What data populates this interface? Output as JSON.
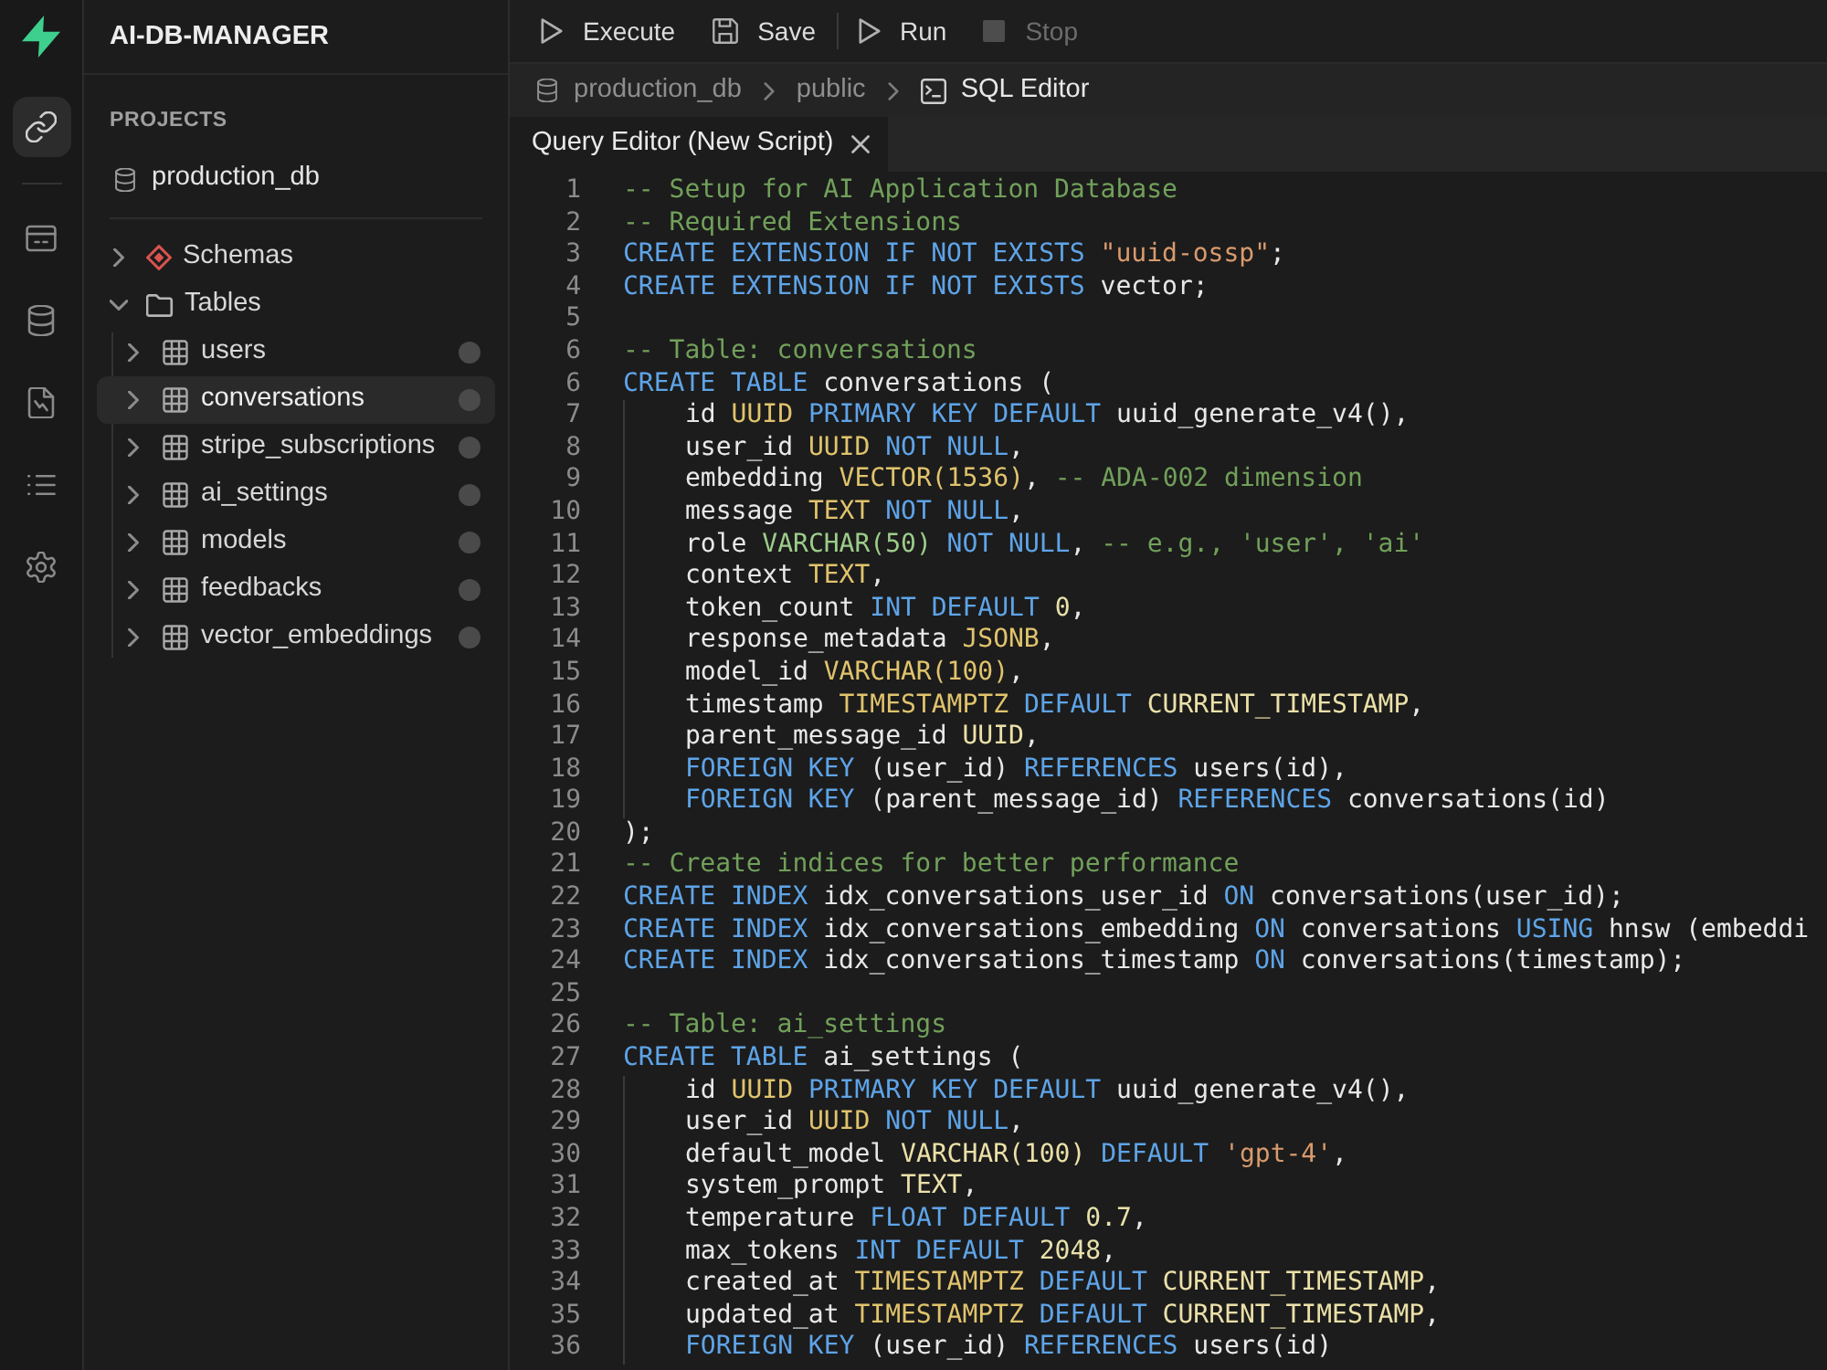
{
  "rail": [
    {
      "kind": "link",
      "selected": true
    },
    {
      "kind": "window",
      "selected": false
    },
    {
      "kind": "database",
      "selected": false
    },
    {
      "kind": "document",
      "selected": false
    },
    {
      "kind": "list",
      "selected": false
    },
    {
      "kind": "gear",
      "selected": false
    }
  ],
  "sidebar": {
    "title": "AI-DB-MANAGER",
    "section": "PROJECTS",
    "project": "production_db",
    "tree": [
      {
        "label": "Schemas",
        "kind": "schema",
        "expanded": false,
        "selected": false
      },
      {
        "label": "Tables",
        "kind": "folder",
        "expanded": true,
        "selected": false,
        "children": [
          {
            "label": "users",
            "kind": "table",
            "expanded": false,
            "selected": false
          },
          {
            "label": "conversations",
            "kind": "table",
            "expanded": false,
            "selected": true
          },
          {
            "label": "stripe_subscriptions",
            "kind": "table",
            "expanded": false,
            "selected": false
          },
          {
            "label": "ai_settings",
            "kind": "table",
            "expanded": false,
            "selected": false
          },
          {
            "label": "models",
            "kind": "table",
            "expanded": false,
            "selected": false
          },
          {
            "label": "feedbacks",
            "kind": "table",
            "expanded": false,
            "selected": false
          },
          {
            "label": "vector_embeddings",
            "kind": "table",
            "expanded": false,
            "selected": false
          }
        ]
      }
    ]
  },
  "toolbar": {
    "groups": [
      {
        "buttons": [
          {
            "label": "Execute",
            "kind": "play",
            "disabled": false
          },
          {
            "label": "Save",
            "kind": "save",
            "disabled": false
          }
        ]
      },
      {
        "buttons": [
          {
            "label": "Run",
            "kind": "play",
            "disabled": false
          },
          {
            "label": "Stop",
            "kind": "stop",
            "disabled": true
          }
        ]
      }
    ]
  },
  "breadcrumb": [
    {
      "label": "production_db",
      "kind": "database",
      "current": false
    },
    {
      "label": "public",
      "kind": "plain",
      "current": false
    },
    {
      "label": "SQL Editor",
      "kind": "editor",
      "current": true
    }
  ],
  "tabs": [
    {
      "label": "Query Editor (New Script)",
      "selected": true
    }
  ],
  "editor": {
    "lines": [
      {
        "number": "1",
        "tokens": [
          {
            "kind": "comment",
            "text": "-- Setup for AI Application Database"
          }
        ]
      },
      {
        "number": "2",
        "tokens": [
          {
            "kind": "comment",
            "text": "-- Required Extensions"
          }
        ]
      },
      {
        "number": "3",
        "tokens": [
          {
            "kind": "keyword",
            "text": "CREATE EXTENSION IF NOT EXISTS "
          },
          {
            "kind": "string",
            "text": "\"uuid-ossp\""
          },
          {
            "kind": "plain",
            "text": ";"
          }
        ]
      },
      {
        "number": "4",
        "tokens": [
          {
            "kind": "keyword",
            "text": "CREATE EXTENSION IF NOT EXISTS "
          },
          {
            "kind": "plain",
            "text": "vector;"
          }
        ]
      },
      {
        "number": "5"
      },
      {
        "number": "6",
        "tokens": [
          {
            "kind": "comment",
            "text": "-- Table: conversations"
          }
        ]
      },
      {
        "number": "6",
        "tokens": [
          {
            "kind": "keyword",
            "text": "CREATE TABLE "
          },
          {
            "kind": "plain",
            "text": "conversations ("
          }
        ],
        "children": [
          {
            "number": "7",
            "tokens": [
              {
                "kind": "plain",
                "text": "id "
              },
              {
                "kind": "type",
                "text": "UUID"
              },
              {
                "kind": "keyword",
                "text": " PRIMARY KEY DEFAULT "
              },
              {
                "kind": "plain",
                "text": "uuid_generate_v4(),"
              }
            ]
          },
          {
            "number": "8",
            "tokens": [
              {
                "kind": "plain",
                "text": "user_id "
              },
              {
                "kind": "type",
                "text": "UUID"
              },
              {
                "kind": "keyword",
                "text": " NOT NULL"
              },
              {
                "kind": "plain",
                "text": ","
              }
            ]
          },
          {
            "number": "9",
            "tokens": [
              {
                "kind": "plain",
                "text": "embedding "
              },
              {
                "kind": "type",
                "text": "VECTOR(1536)"
              },
              {
                "kind": "plain",
                "text": ", "
              },
              {
                "kind": "comment",
                "text": "-- ADA-002 dimension"
              }
            ]
          },
          {
            "number": "10",
            "tokens": [
              {
                "kind": "plain",
                "text": "message "
              },
              {
                "kind": "type",
                "text": "TEXT"
              },
              {
                "kind": "keyword",
                "text": " NOT NULL"
              },
              {
                "kind": "plain",
                "text": ","
              }
            ]
          },
          {
            "number": "11",
            "tokens": [
              {
                "kind": "plain",
                "text": "role "
              },
              {
                "kind": "builtin",
                "text": "VARCHAR(50)"
              },
              {
                "kind": "keyword",
                "text": " NOT NULL"
              },
              {
                "kind": "plain",
                "text": ", "
              },
              {
                "kind": "comment",
                "text": "-- e.g., 'user', 'ai'"
              }
            ]
          },
          {
            "number": "12",
            "tokens": [
              {
                "kind": "plain",
                "text": "context "
              },
              {
                "kind": "type",
                "text": "TEXT"
              },
              {
                "kind": "plain",
                "text": ","
              }
            ]
          },
          {
            "number": "13",
            "tokens": [
              {
                "kind": "plain",
                "text": "token_count "
              },
              {
                "kind": "keyword",
                "text": "INT DEFAULT "
              },
              {
                "kind": "number",
                "text": "0"
              },
              {
                "kind": "plain",
                "text": ","
              }
            ]
          },
          {
            "number": "14",
            "tokens": [
              {
                "kind": "plain",
                "text": "response_metadata "
              },
              {
                "kind": "type",
                "text": "JSONB"
              },
              {
                "kind": "plain",
                "text": ","
              }
            ]
          },
          {
            "number": "15",
            "tokens": [
              {
                "kind": "plain",
                "text": "model_id "
              },
              {
                "kind": "type",
                "text": "VARCHAR(100)"
              },
              {
                "kind": "plain",
                "text": ","
              }
            ]
          },
          {
            "number": "16",
            "tokens": [
              {
                "kind": "plain",
                "text": "timestamp "
              },
              {
                "kind": "type",
                "text": "TIMESTAMPTZ"
              },
              {
                "kind": "keyword",
                "text": " DEFAULT "
              },
              {
                "kind": "constant",
                "text": "CURRENT_TIMESTAMP"
              },
              {
                "kind": "plain",
                "text": ","
              }
            ]
          },
          {
            "number": "17",
            "tokens": [
              {
                "kind": "plain",
                "text": "parent_message_id "
              },
              {
                "kind": "constant",
                "text": "UUID"
              },
              {
                "kind": "plain",
                "text": ","
              }
            ]
          },
          {
            "number": "18",
            "tokens": [
              {
                "kind": "keyword",
                "text": "FOREIGN KEY "
              },
              {
                "kind": "plain",
                "text": "(user_id) "
              },
              {
                "kind": "keyword",
                "text": "REFERENCES "
              },
              {
                "kind": "plain",
                "text": "users(id),"
              }
            ]
          },
          {
            "number": "19",
            "tokens": [
              {
                "kind": "keyword",
                "text": "FOREIGN KEY "
              },
              {
                "kind": "plain",
                "text": "(parent_message_id) "
              },
              {
                "kind": "keyword",
                "text": "REFERENCES "
              },
              {
                "kind": "plain",
                "text": "conversations(id)"
              }
            ]
          }
        ]
      },
      {
        "number": "20",
        "tokens": [
          {
            "kind": "plain",
            "text": ");"
          }
        ]
      },
      {
        "number": "21",
        "tokens": [
          {
            "kind": "comment",
            "text": "-- Create indices for better performance"
          }
        ]
      },
      {
        "number": "22",
        "tokens": [
          {
            "kind": "keyword",
            "text": "CREATE INDEX "
          },
          {
            "kind": "plain",
            "text": "idx_conversations_user_id "
          },
          {
            "kind": "keyword",
            "text": "ON "
          },
          {
            "kind": "plain",
            "text": "conversations(user_id);"
          }
        ]
      },
      {
        "number": "23",
        "tokens": [
          {
            "kind": "keyword",
            "text": "CREATE INDEX "
          },
          {
            "kind": "plain",
            "text": "idx_conversations_embedding "
          },
          {
            "kind": "keyword",
            "text": "ON "
          },
          {
            "kind": "plain",
            "text": "conversations "
          },
          {
            "kind": "keyword",
            "text": "USING "
          },
          {
            "kind": "plain",
            "text": "hnsw (embeddi"
          }
        ]
      },
      {
        "number": "24",
        "tokens": [
          {
            "kind": "keyword",
            "text": "CREATE INDEX "
          },
          {
            "kind": "plain",
            "text": "idx_conversations_timestamp "
          },
          {
            "kind": "keyword",
            "text": "ON "
          },
          {
            "kind": "plain",
            "text": "conversations(timestamp);"
          }
        ]
      },
      {
        "number": "25"
      },
      {
        "number": "26",
        "tokens": [
          {
            "kind": "comment",
            "text": "-- Table: ai_settings"
          }
        ]
      },
      {
        "number": "27",
        "tokens": [
          {
            "kind": "keyword",
            "text": "CREATE TABLE "
          },
          {
            "kind": "plain",
            "text": "ai_settings ("
          }
        ],
        "children": [
          {
            "number": "28",
            "tokens": [
              {
                "kind": "plain",
                "text": "id "
              },
              {
                "kind": "type",
                "text": "UUID"
              },
              {
                "kind": "keyword",
                "text": " PRIMARY KEY DEFAULT "
              },
              {
                "kind": "plain",
                "text": "uuid_generate_v4(),"
              }
            ]
          },
          {
            "number": "29",
            "tokens": [
              {
                "kind": "plain",
                "text": "user_id "
              },
              {
                "kind": "type",
                "text": "UUID"
              },
              {
                "kind": "keyword",
                "text": " NOT NULL"
              },
              {
                "kind": "plain",
                "text": ","
              }
            ]
          },
          {
            "number": "30",
            "tokens": [
              {
                "kind": "plain",
                "text": "default_model "
              },
              {
                "kind": "constant",
                "text": "VARCHAR(100)"
              },
              {
                "kind": "keyword",
                "text": " DEFAULT "
              },
              {
                "kind": "string",
                "text": "'gpt-4'"
              },
              {
                "kind": "plain",
                "text": ","
              }
            ]
          },
          {
            "number": "31",
            "tokens": [
              {
                "kind": "plain",
                "text": "system_prompt "
              },
              {
                "kind": "constant",
                "text": "TEXT"
              },
              {
                "kind": "plain",
                "text": ","
              }
            ]
          },
          {
            "number": "32",
            "tokens": [
              {
                "kind": "plain",
                "text": "temperature "
              },
              {
                "kind": "keyword",
                "text": "FLOAT DEFAULT "
              },
              {
                "kind": "number",
                "text": "0.7"
              },
              {
                "kind": "plain",
                "text": ","
              }
            ]
          },
          {
            "number": "33",
            "tokens": [
              {
                "kind": "plain",
                "text": "max_tokens "
              },
              {
                "kind": "keyword",
                "text": "INT DEFAULT "
              },
              {
                "kind": "number",
                "text": "2048"
              },
              {
                "kind": "plain",
                "text": ","
              }
            ]
          },
          {
            "number": "34",
            "tokens": [
              {
                "kind": "plain",
                "text": "created_at "
              },
              {
                "kind": "type",
                "text": "TIMESTAMPTZ"
              },
              {
                "kind": "keyword",
                "text": " DEFAULT "
              },
              {
                "kind": "constant",
                "text": "CURRENT_TIMESTAMP"
              },
              {
                "kind": "plain",
                "text": ","
              }
            ]
          },
          {
            "number": "35",
            "tokens": [
              {
                "kind": "plain",
                "text": "updated_at "
              },
              {
                "kind": "type",
                "text": "TIMESTAMPTZ"
              },
              {
                "kind": "keyword",
                "text": " DEFAULT "
              },
              {
                "kind": "constant",
                "text": "CURRENT_TIMESTAMP"
              },
              {
                "kind": "plain",
                "text": ","
              }
            ]
          },
          {
            "number": "36",
            "tokens": [
              {
                "kind": "keyword",
                "text": "FOREIGN KEY "
              },
              {
                "kind": "plain",
                "text": "(user_id) "
              },
              {
                "kind": "keyword",
                "text": "REFERENCES "
              },
              {
                "kind": "plain",
                "text": "users(id)"
              }
            ]
          }
        ]
      }
    ]
  }
}
